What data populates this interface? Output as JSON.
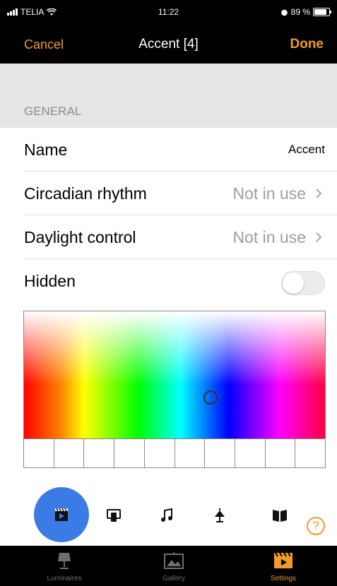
{
  "status": {
    "carrier": "TELIA",
    "time": "11:22",
    "battery": "89 %",
    "battery_level": 0.89
  },
  "nav": {
    "cancel": "Cancel",
    "title": "Accent [4]",
    "done": "Done"
  },
  "section": {
    "header": "GENERAL"
  },
  "rows": {
    "name": {
      "label": "Name",
      "value": "Accent"
    },
    "circadian": {
      "label": "Circadian rhythm",
      "value": "Not in use"
    },
    "daylight": {
      "label": "Daylight control",
      "value": "Not in use"
    },
    "hidden": {
      "label": "Hidden",
      "on": false
    }
  },
  "picker": {
    "cursor_hue_fraction": 0.62,
    "cursor_saturation_fraction": 0.68,
    "swatch_count": 10
  },
  "toolbar": {
    "tools": [
      "scene-icon",
      "remote-icon",
      "music-icon",
      "lamp-icon",
      "book-icon"
    ],
    "active": "scene-icon",
    "help": "?"
  },
  "tabs": [
    {
      "label": "Luminaires",
      "icon": "luminaire-icon",
      "active": false
    },
    {
      "label": "Gallery",
      "icon": "gallery-icon",
      "active": false
    },
    {
      "label": "Settings",
      "icon": "settings-icon",
      "active": true
    }
  ],
  "colors": {
    "accent": "#f39a25",
    "active_tool": "#3a7be6"
  }
}
